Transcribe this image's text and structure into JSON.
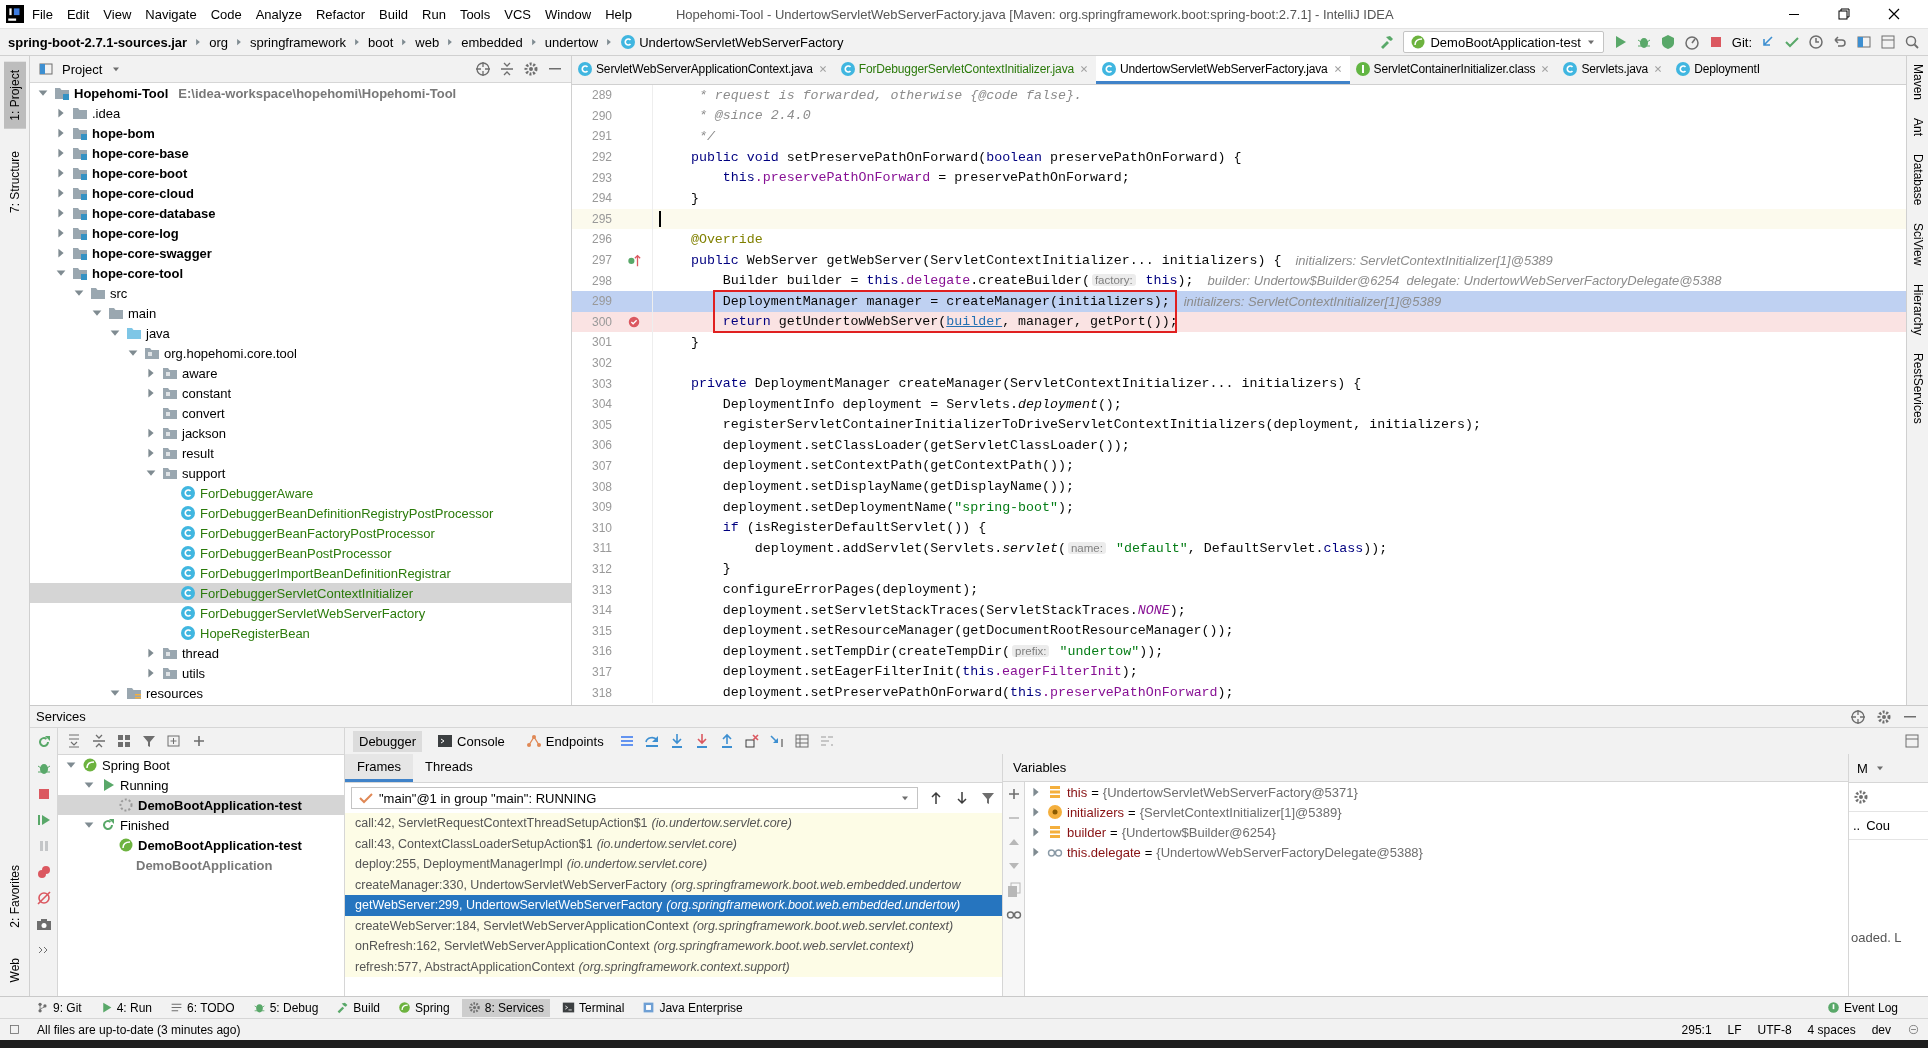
{
  "menu_bar": {
    "items": [
      "File",
      "Edit",
      "View",
      "Navigate",
      "Code",
      "Analyze",
      "Refactor",
      "Build",
      "Run",
      "Tools",
      "VCS",
      "Window",
      "Help"
    ],
    "title": "Hopehomi-Tool - UndertowServletWebServerFactory.java [Maven: org.springframework.boot:spring-boot:2.7.1] - IntelliJ IDEA"
  },
  "nav_bar": {
    "breadcrumbs": [
      {
        "label": "spring-boot-2.7.1-sources.jar",
        "kind": "jar"
      },
      {
        "label": "org",
        "kind": "package"
      },
      {
        "label": "springframework",
        "kind": "package"
      },
      {
        "label": "boot",
        "kind": "package"
      },
      {
        "label": "web",
        "kind": "package"
      },
      {
        "label": "embedded",
        "kind": "package"
      },
      {
        "label": "undertow",
        "kind": "package"
      },
      {
        "label": "UndertowServletWebServerFactory",
        "kind": "class"
      }
    ],
    "run_config": "DemoBootApplication-test",
    "vcs_label": "Git:"
  },
  "left_stripe_top": [
    {
      "label": "1: Project",
      "selected": true
    },
    {
      "label": "7: Structure",
      "selected": false
    }
  ],
  "left_stripe_bottom": [
    {
      "label": "2: Favorites",
      "selected": false
    },
    {
      "label": "Web",
      "selected": false
    }
  ],
  "project": {
    "title": "Project",
    "tree": [
      {
        "label": "Hopehomi-Tool",
        "path": "E:\\idea-workspace\\hopehomi\\Hopehomi-Tool",
        "kind": "module",
        "expanded": true,
        "selected": false,
        "children": [
          {
            "label": ".idea",
            "kind": "folder",
            "expanded": false,
            "selected": false
          },
          {
            "label": "hope-bom",
            "kind": "module",
            "expanded": false,
            "selected": false
          },
          {
            "label": "hope-core-base",
            "kind": "module",
            "expanded": false,
            "selected": false
          },
          {
            "label": "hope-core-boot",
            "kind": "module",
            "expanded": false,
            "selected": false
          },
          {
            "label": "hope-core-cloud",
            "kind": "module",
            "expanded": false,
            "selected": false
          },
          {
            "label": "hope-core-database",
            "kind": "module",
            "expanded": false,
            "selected": false
          },
          {
            "label": "hope-core-log",
            "kind": "module",
            "expanded": false,
            "selected": false
          },
          {
            "label": "hope-core-swagger",
            "kind": "module",
            "expanded": false,
            "selected": false
          },
          {
            "label": "hope-core-tool",
            "kind": "module",
            "expanded": true,
            "selected": false,
            "children": [
              {
                "label": "src",
                "kind": "folder",
                "expanded": true,
                "selected": false,
                "children": [
                  {
                    "label": "main",
                    "kind": "folder",
                    "expanded": true,
                    "selected": false,
                    "children": [
                      {
                        "label": "java",
                        "kind": "source_root",
                        "expanded": true,
                        "selected": false,
                        "children": [
                          {
                            "label": "org.hopehomi.core.tool",
                            "kind": "package",
                            "expanded": true,
                            "selected": false,
                            "children": [
                              {
                                "label": "aware",
                                "kind": "package",
                                "expanded": false,
                                "selected": false
                              },
                              {
                                "label": "constant",
                                "kind": "package",
                                "expanded": false,
                                "selected": false
                              },
                              {
                                "label": "convert",
                                "kind": "package",
                                "selected": false
                              },
                              {
                                "label": "jackson",
                                "kind": "package",
                                "expanded": false,
                                "selected": false
                              },
                              {
                                "label": "result",
                                "kind": "package",
                                "expanded": false,
                                "selected": false
                              },
                              {
                                "label": "support",
                                "kind": "package",
                                "expanded": true,
                                "selected": false,
                                "children": [
                                  {
                                    "label": "ForDebuggerAware",
                                    "kind": "class",
                                    "selected": false
                                  },
                                  {
                                    "label": "ForDebuggerBeanDefinitionRegistryPostProcessor",
                                    "kind": "class",
                                    "selected": false
                                  },
                                  {
                                    "label": "ForDebuggerBeanFactoryPostProcessor",
                                    "kind": "class",
                                    "selected": false
                                  },
                                  {
                                    "label": "ForDebuggerBeanPostProcessor",
                                    "kind": "class",
                                    "selected": false
                                  },
                                  {
                                    "label": "ForDebuggerImportBeanDefinitionRegistrar",
                                    "kind": "class",
                                    "selected": false
                                  },
                                  {
                                    "label": "ForDebuggerServletContextInitializer",
                                    "kind": "class",
                                    "selected": true
                                  },
                                  {
                                    "label": "ForDebuggerServletWebServerFactory",
                                    "kind": "class",
                                    "selected": false
                                  },
                                  {
                                    "label": "HopeRegisterBean",
                                    "kind": "class",
                                    "selected": false
                                  }
                                ]
                              },
                              {
                                "label": "thread",
                                "kind": "package",
                                "expanded": false,
                                "selected": false
                              },
                              {
                                "label": "utils",
                                "kind": "package",
                                "expanded": false,
                                "selected": false
                              }
                            ]
                          }
                        ]
                      },
                      {
                        "label": "resources",
                        "kind": "resources",
                        "expanded": true,
                        "selected": false
                      }
                    ]
                  }
                ]
              }
            ]
          }
        ]
      }
    ]
  },
  "editor": {
    "tabs": [
      {
        "label": "ServletWebServerApplicationContext.java",
        "kind": "library_class",
        "selected": false
      },
      {
        "label": "ForDebuggerServletContextInitializer.java",
        "kind": "project_class",
        "selected": false
      },
      {
        "label": "UndertowServletWebServerFactory.java",
        "kind": "library_class",
        "selected": true
      },
      {
        "label": "ServletContainerInitializer.class",
        "kind": "library_interface",
        "selected": false
      },
      {
        "label": "Servlets.java",
        "kind": "library_class",
        "selected": false
      },
      {
        "label": "DeploymentI",
        "kind": "library_class",
        "selected": false
      }
    ],
    "lines": [
      {
        "number": "289",
        "tokens": [
          {
            "kind": "comment",
            "text": "     * request is forwarded, otherwise {@code false}."
          }
        ]
      },
      {
        "number": "290",
        "tokens": [
          {
            "kind": "comment",
            "text": "     * @since 2.4.0"
          }
        ]
      },
      {
        "number": "291",
        "tokens": [
          {
            "kind": "comment",
            "text": "     */"
          }
        ]
      },
      {
        "number": "292",
        "tokens": [
          {
            "kind": "keyword",
            "text": "    public void "
          },
          {
            "kind": "plain",
            "text": "setPreservePathOnForward("
          },
          {
            "kind": "keyword",
            "text": "boolean"
          },
          {
            "kind": "plain",
            "text": " preservePathOnForward) {"
          }
        ]
      },
      {
        "number": "293",
        "tokens": [
          {
            "kind": "keyword",
            "text": "        this"
          },
          {
            "kind": "field",
            "text": ".preservePathOnForward"
          },
          {
            "kind": "plain",
            "text": " = preservePathOnForward;"
          }
        ]
      },
      {
        "number": "294",
        "tokens": [
          {
            "kind": "plain",
            "text": "    }"
          }
        ]
      },
      {
        "number": "295",
        "kind": "caret"
      },
      {
        "number": "296",
        "tokens": [
          {
            "kind": "annotation",
            "text": "    @Override"
          }
        ]
      },
      {
        "number": "297",
        "kind": "override",
        "tokens": [
          {
            "kind": "keyword",
            "text": "    public "
          },
          {
            "kind": "plain",
            "text": "WebServer getWebServer(ServletContextInitializer... initializers) {"
          }
        ],
        "debug_value": "initializers: ServletContextInitializer[1]@5389"
      },
      {
        "number": "298",
        "tokens": [
          {
            "kind": "plain",
            "text": "        Builder builder = "
          },
          {
            "kind": "keyword",
            "text": "this"
          },
          {
            "kind": "field",
            "text": ".delegate"
          },
          {
            "kind": "plain",
            "text": ".createBuilder("
          },
          {
            "kind": "param_hint",
            "text": "factory:"
          },
          {
            "kind": "keyword",
            "text": " this"
          },
          {
            "kind": "plain",
            "text": ");"
          }
        ],
        "debug_value": "builder: Undertow$Builder@6254  delegate: UndertowWebServerFactoryDelegate@5388"
      },
      {
        "number": "299",
        "kind": "execution",
        "boxed": true,
        "tokens": [
          {
            "kind": "plain",
            "text": "        DeploymentManager manager = createManager(initializers);"
          }
        ],
        "debug_value": "initializers: ServletContextInitializer[1]@5389"
      },
      {
        "number": "300",
        "kind": "breakpoint",
        "boxed": true,
        "tokens": [
          {
            "kind": "keyword",
            "text": "        return"
          },
          {
            "kind": "plain",
            "text": " getUndertowWebServer("
          },
          {
            "kind": "link",
            "text": "builder"
          },
          {
            "kind": "plain",
            "text": ", manager, getPort());"
          }
        ]
      },
      {
        "number": "301",
        "tokens": [
          {
            "kind": "plain",
            "text": "    }"
          }
        ]
      },
      {
        "number": "302"
      },
      {
        "number": "303",
        "tokens": [
          {
            "kind": "keyword",
            "text": "    private "
          },
          {
            "kind": "plain",
            "text": "DeploymentManager createManager(ServletContextInitializer... initializers) {"
          }
        ]
      },
      {
        "number": "304",
        "tokens": [
          {
            "kind": "plain",
            "text": "        DeploymentInfo deployment = Servlets."
          },
          {
            "kind": "static",
            "text": "deployment"
          },
          {
            "kind": "plain",
            "text": "();"
          }
        ]
      },
      {
        "number": "305",
        "tokens": [
          {
            "kind": "plain",
            "text": "        registerServletContainerInitializerToDriveServletContextInitializers(deployment, initializers);"
          }
        ]
      },
      {
        "number": "306",
        "tokens": [
          {
            "kind": "plain",
            "text": "        deployment.setClassLoader(getServletClassLoader());"
          }
        ]
      },
      {
        "number": "307",
        "tokens": [
          {
            "kind": "plain",
            "text": "        deployment.setContextPath(getContextPath());"
          }
        ]
      },
      {
        "number": "308",
        "tokens": [
          {
            "kind": "plain",
            "text": "        deployment.setDisplayName(getDisplayName());"
          }
        ]
      },
      {
        "number": "309",
        "tokens": [
          {
            "kind": "plain",
            "text": "        deployment.setDeploymentName("
          },
          {
            "kind": "string",
            "text": "\"spring-boot\""
          },
          {
            "kind": "plain",
            "text": ");"
          }
        ]
      },
      {
        "number": "310",
        "tokens": [
          {
            "kind": "keyword",
            "text": "        if"
          },
          {
            "kind": "plain",
            "text": " (isRegisterDefaultServlet()) {"
          }
        ]
      },
      {
        "number": "311",
        "tokens": [
          {
            "kind": "plain",
            "text": "            deployment.addServlet(Servlets."
          },
          {
            "kind": "static",
            "text": "servlet"
          },
          {
            "kind": "plain",
            "text": "("
          },
          {
            "kind": "param_hint",
            "text": "name:"
          },
          {
            "kind": "string",
            "text": " \"default\""
          },
          {
            "kind": "plain",
            "text": ", DefaultServlet."
          },
          {
            "kind": "keyword",
            "text": "class"
          },
          {
            "kind": "plain",
            "text": "));"
          }
        ]
      },
      {
        "number": "312",
        "tokens": [
          {
            "kind": "plain",
            "text": "        }"
          }
        ]
      },
      {
        "number": "313",
        "tokens": [
          {
            "kind": "plain",
            "text": "        configureErrorPages(deployment);"
          }
        ]
      },
      {
        "number": "314",
        "tokens": [
          {
            "kind": "plain",
            "text": "        deployment.setServletStackTraces(ServletStackTraces."
          },
          {
            "kind": "constant",
            "text": "NONE"
          },
          {
            "kind": "plain",
            "text": ");"
          }
        ]
      },
      {
        "number": "315",
        "tokens": [
          {
            "kind": "plain",
            "text": "        deployment.setResourceManager(getDocumentRootResourceManager());"
          }
        ]
      },
      {
        "number": "316",
        "tokens": [
          {
            "kind": "plain",
            "text": "        deployment.setTempDir(createTempDir("
          },
          {
            "kind": "param_hint",
            "text": "prefix:"
          },
          {
            "kind": "string",
            "text": " \"undertow\""
          },
          {
            "kind": "plain",
            "text": "));"
          }
        ]
      },
      {
        "number": "317",
        "tokens": [
          {
            "kind": "plain",
            "text": "        deployment.setEagerFilterInit("
          },
          {
            "kind": "keyword",
            "text": "this"
          },
          {
            "kind": "field",
            "text": ".eagerFilterInit"
          },
          {
            "kind": "plain",
            "text": ");"
          }
        ]
      },
      {
        "number": "318",
        "tokens": [
          {
            "kind": "plain",
            "text": "        deployment.setPreservePathOnForward("
          },
          {
            "kind": "keyword",
            "text": "this"
          },
          {
            "kind": "field",
            "text": ".preservePathOnForward"
          },
          {
            "kind": "plain",
            "text": ");"
          }
        ]
      }
    ]
  },
  "right_stripe": [
    "Maven",
    "Ant",
    "Database",
    "SciView",
    "Hierarchy",
    "RestServices"
  ],
  "services": {
    "title": "Services",
    "tree": [
      {
        "label": "Spring Boot",
        "kind": "spring_boot",
        "expanded": true,
        "selected": false,
        "children": [
          {
            "label": "Running",
            "kind": "running",
            "expanded": true,
            "selected": false,
            "children": [
              {
                "label": "DemoBootApplication-test",
                "kind": "app_running",
                "selected": true
              }
            ]
          },
          {
            "label": "Finished",
            "kind": "finished",
            "expanded": true,
            "selected": false,
            "children": [
              {
                "label": "DemoBootApplication-test",
                "kind": "app_finished",
                "selected": false
              },
              {
                "label": "DemoBootApplication",
                "kind": "app_stopped",
                "selected": false
              }
            ]
          }
        ]
      }
    ],
    "debugger_tabs": [
      {
        "label": "Debugger",
        "kind": "debugger",
        "selected": true
      },
      {
        "label": "Console",
        "kind": "console",
        "selected": false
      },
      {
        "label": "Endpoints",
        "kind": "endpoints",
        "selected": false
      }
    ],
    "frame_tabs": [
      {
        "label": "Frames",
        "selected": true
      },
      {
        "label": "Threads",
        "selected": false
      }
    ],
    "thread": "\"main\"@1 in group \"main\": RUNNING",
    "frames": [
      {
        "method": "call:42, ServletRequestContextThreadSetupAction$1",
        "package": "(io.undertow.servlet.core)",
        "selected": false
      },
      {
        "method": "call:43, ContextClassLoaderSetupAction$1",
        "package": "(io.undertow.servlet.core)",
        "selected": false
      },
      {
        "method": "deploy:255, DeploymentManagerImpl",
        "package": "(io.undertow.servlet.core)",
        "selected": false
      },
      {
        "method": "createManager:330, UndertowServletWebServerFactory",
        "package": "(org.springframework.boot.web.embedded.undertow",
        "selected": false
      },
      {
        "method": "getWebServer:299, UndertowServletWebServerFactory",
        "package": "(org.springframework.boot.web.embedded.undertow)",
        "selected": true
      },
      {
        "method": "createWebServer:184, ServletWebServerApplicationContext",
        "package": "(org.springframework.boot.web.servlet.context)",
        "selected": false
      },
      {
        "method": "onRefresh:162, ServletWebServerApplicationContext",
        "package": "(org.springframework.boot.web.servlet.context)",
        "selected": false
      },
      {
        "method": "refresh:577, AbstractApplicationContext",
        "package": "(org.springframework.context.support)",
        "selected": false
      }
    ],
    "variables": {
      "title": "Variables",
      "items": [
        {
          "kind": "field",
          "name": "this",
          "operator": "=",
          "value": "{UndertowServletWebServerFactory@5371}",
          "expanded": false
        },
        {
          "kind": "parameter",
          "name": "initializers",
          "operator": "=",
          "value": "{ServletContextInitializer[1]@5389}",
          "expanded": false
        },
        {
          "kind": "field",
          "name": "builder",
          "operator": "=",
          "value": "{Undertow$Builder@6254}",
          "expanded": false
        },
        {
          "kind": "watch",
          "name": "this.delegate",
          "operator": "=",
          "value": "{UndertowWebServerFactoryDelegate@5388}",
          "expanded": false
        }
      ]
    },
    "side_panel": {
      "tab": "M",
      "column_1": "..",
      "column_2": "Cou",
      "message": "oaded. L"
    }
  },
  "tool_tabs": [
    {
      "label": "9: Git",
      "kind": "git",
      "selected": false
    },
    {
      "label": "4: Run",
      "kind": "run",
      "selected": false
    },
    {
      "label": "6: TODO",
      "kind": "todo",
      "selected": false
    },
    {
      "label": "5: Debug",
      "kind": "debug",
      "selected": false
    },
    {
      "label": "Build",
      "kind": "build",
      "selected": false
    },
    {
      "label": "Spring",
      "kind": "spring",
      "selected": false
    },
    {
      "label": "8: Services",
      "kind": "services",
      "selected": true
    },
    {
      "label": "Terminal",
      "kind": "terminal",
      "selected": false
    },
    {
      "label": "Java Enterprise",
      "kind": "enterprise",
      "selected": false
    }
  ],
  "event_log": "Event Log",
  "status_bar": {
    "message": "All files are up-to-date (3 minutes ago)",
    "items": [
      "295:1",
      "LF",
      "UTF-8",
      "4 spaces",
      "dev"
    ]
  }
}
